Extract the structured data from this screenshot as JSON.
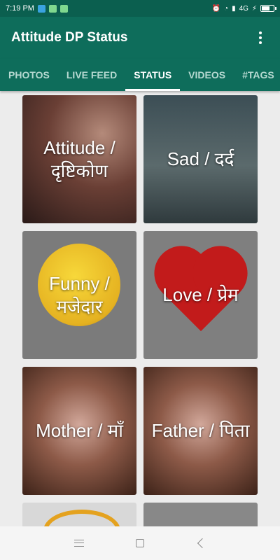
{
  "status_bar": {
    "time": "7:19 PM",
    "network": "4G"
  },
  "app_bar": {
    "title": "Attitude DP Status"
  },
  "tabs": [
    {
      "label": "PHOTOS",
      "active": false
    },
    {
      "label": "LIVE FEED",
      "active": false
    },
    {
      "label": "STATUS",
      "active": true
    },
    {
      "label": "VIDEOS",
      "active": false
    },
    {
      "label": "#TAGS",
      "active": false
    }
  ],
  "cards": [
    {
      "label": "Attitude / दृष्टिकोण"
    },
    {
      "label": "Sad / दर्द"
    },
    {
      "label": "Funny / मजेदार"
    },
    {
      "label": "Love / प्रेम"
    },
    {
      "label": "Mother / माँ"
    },
    {
      "label": "Father / पिता"
    }
  ],
  "colors": {
    "app_bar": "#0e6d5b",
    "status_bar": "#0b5f4f",
    "tab_indicator": "#ffffff",
    "background": "#ececec"
  }
}
